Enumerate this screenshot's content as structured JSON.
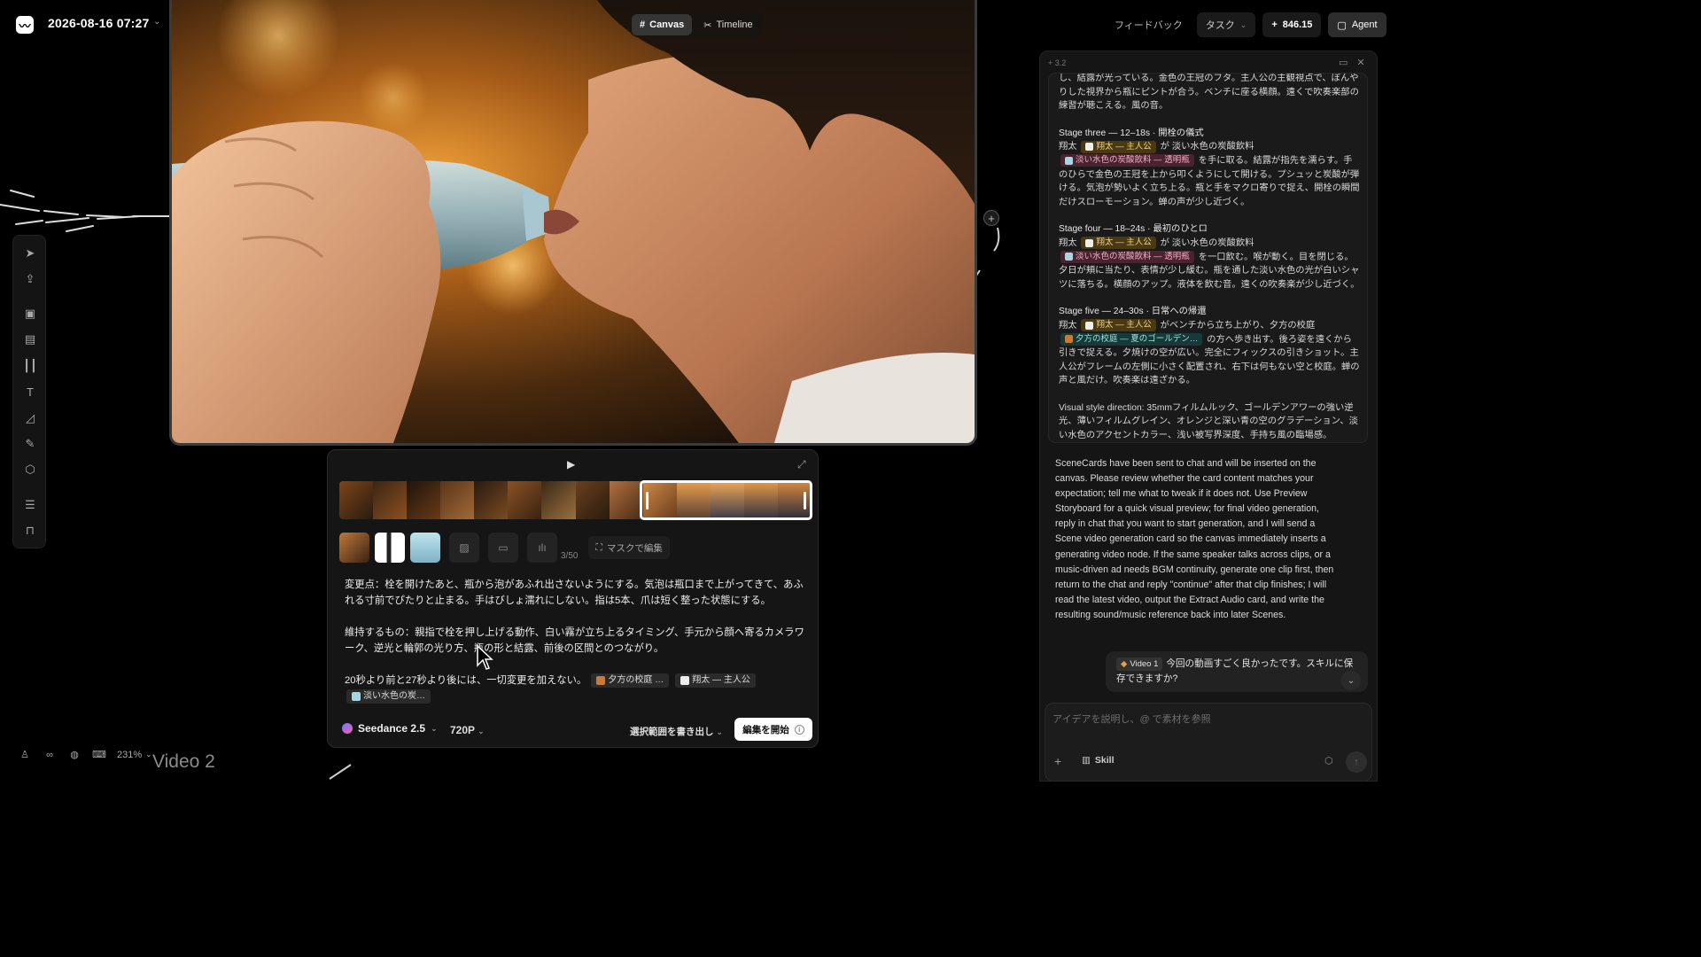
{
  "header": {
    "logo_glyph": "〰",
    "title": "2026-08-16 07:27",
    "title_chevron": "⌄",
    "settings_icon": "⚙"
  },
  "modes": {
    "canvas": "Canvas",
    "timeline": "Timeline"
  },
  "toolbar_icons": [
    "cursor-icon",
    "upload-icon",
    "image-gen-icon",
    "video-gen-icon",
    "audio-icon",
    "text-icon",
    "note-icon",
    "brush-icon",
    "cube-icon",
    "layers-icon",
    "bag-icon"
  ],
  "status": {
    "zoom": "231%",
    "node_label": "Video 2"
  },
  "editor": {
    "ref_count": "3/50",
    "mask_label": "マスクで編集",
    "para1": "変更点：栓を開けたあと、瓶から泡があふれ出さないようにする。気泡は瓶口まで上がってきて、あふれる寸前でぴたりと止まる。手はびしょ濡れにしない。指は5本、爪は短く整った状態にする。",
    "para2": "維持するもの：親指で栓を押し上げる動作、白い霧が立ち上るタイミング、手元から顔へ寄るカメラワーク、逆光と輪郭の光り方、瓶の形と結露、前後の区間とのつながり。",
    "para3": "20秒より前と27秒より後には、一切変更を加えない。",
    "chip_scene": "夕方の校庭 …",
    "chip_hero": "翔太 — 主人公",
    "chip_drink": "淡い水色の炭…",
    "model": "Seedance 2.5",
    "resolution": "720P",
    "export_label": "選択範囲を書き出し",
    "start_label": "編集を開始"
  },
  "topbar": {
    "feedback": "フィードバック",
    "tasks": "タスク",
    "credits": "846.15",
    "agent": "Agent"
  },
  "chat": {
    "version": "+ 3.2",
    "intro_line1": "し、結露が光っている。金色の王冠のフタ。主人公の主観視点で、ぼんやりした視界から瓶にピントが合う。ベンチに座る横顔。遠くで吹奏楽部の練習が聴こえる。風の音。",
    "stage3_title": "Stage three — 12–18s · 開栓の儀式",
    "stage3_who": "翔太",
    "stage3_hero": "翔太 — 主人公",
    "stage3_mid": "が 淡い水色の炭酸飲料",
    "stage3_drink": "淡い水色の炭酸飲料 — 透明瓶",
    "stage3_body": "を手に取る。結露が指先を濡らす。手のひらで金色の王冠を上から叩くようにして開ける。プシュッと炭酸が弾ける。気泡が勢いよく立ち上る。瓶と手をマクロ寄りで捉え、開栓の瞬間だけスローモーション。蝉の声が少し近づく。",
    "stage4_title": "Stage four — 18–24s · 最初のひとロ",
    "stage4_who": "翔太",
    "stage4_hero": "翔太 — 主人公",
    "stage4_mid": "が 淡い水色の炭酸飲料",
    "stage4_drink": "淡い水色の炭酸飲料 — 透明瓶",
    "stage4_body": "を一口飲む。喉が動く。目を閉じる。夕日が頬に当たり、表情が少し緩む。瓶を通した淡い水色の光が白いシャツに落ちる。横顔のアップ。液体を飲む音。遠くの吹奏楽が少し近づく。",
    "stage5_title": "Stage five — 24–30s · 日常への帰還",
    "stage5_who": "翔太",
    "stage5_hero": "翔太 — 主人公",
    "stage5_mid": "がベンチから立ち上がり、夕方の校庭",
    "stage5_scene": "夕方の校庭 — 夏のゴールデン…",
    "stage5_body": "の方へ歩き出す。後ろ姿を遠くから引きで捉える。夕焼けの空が広い。完全にフィックスの引きショット。主人公がフレームの左側に小さく配置され、右下は何もない空と校庭。蝉の声と風だけ。吹奏楽は遠ざかる。",
    "style_direction": "Visual style direction: 35mmフィルムルック、ゴールデンアワーの強い逆光、薄いフィルムグレイン、オレンジと深い青の空のグラデーション、淡い水色のアクセントカラー、浅い被写界深度、手持ち風の臨場感。",
    "assistant_msg": "SceneCards have been sent to chat and will be inserted on the canvas. Please review whether the card content matches your expectation; tell me what to tweak if it does not. Use Preview Storyboard for a quick visual preview; for final video generation, reply in chat that you want to start generation, and I will send a Scene video generation card so the canvas immediately inserts a generating video node. If the same speaker talks across clips, or a music-driven ad needs BGM continuity, generate one clip first, then return to the chat and reply \"continue\" after that clip finishes; I will read the latest video, output the Extract Audio card, and write the resulting sound/music reference back into later Scenes.",
    "user_chip": "Video 1",
    "user_msg": "今回の動画すごく良かったです。スキルに保存できますか?",
    "input_placeholder": "アイデアを説明し、@ で素材を参照",
    "skill_label": "Skill"
  },
  "colors": {
    "accent_gold": "#f1d083",
    "accent_pink": "#f2b3c6",
    "accent_teal": "#9fe0d8",
    "panel_bg": "#151515"
  }
}
